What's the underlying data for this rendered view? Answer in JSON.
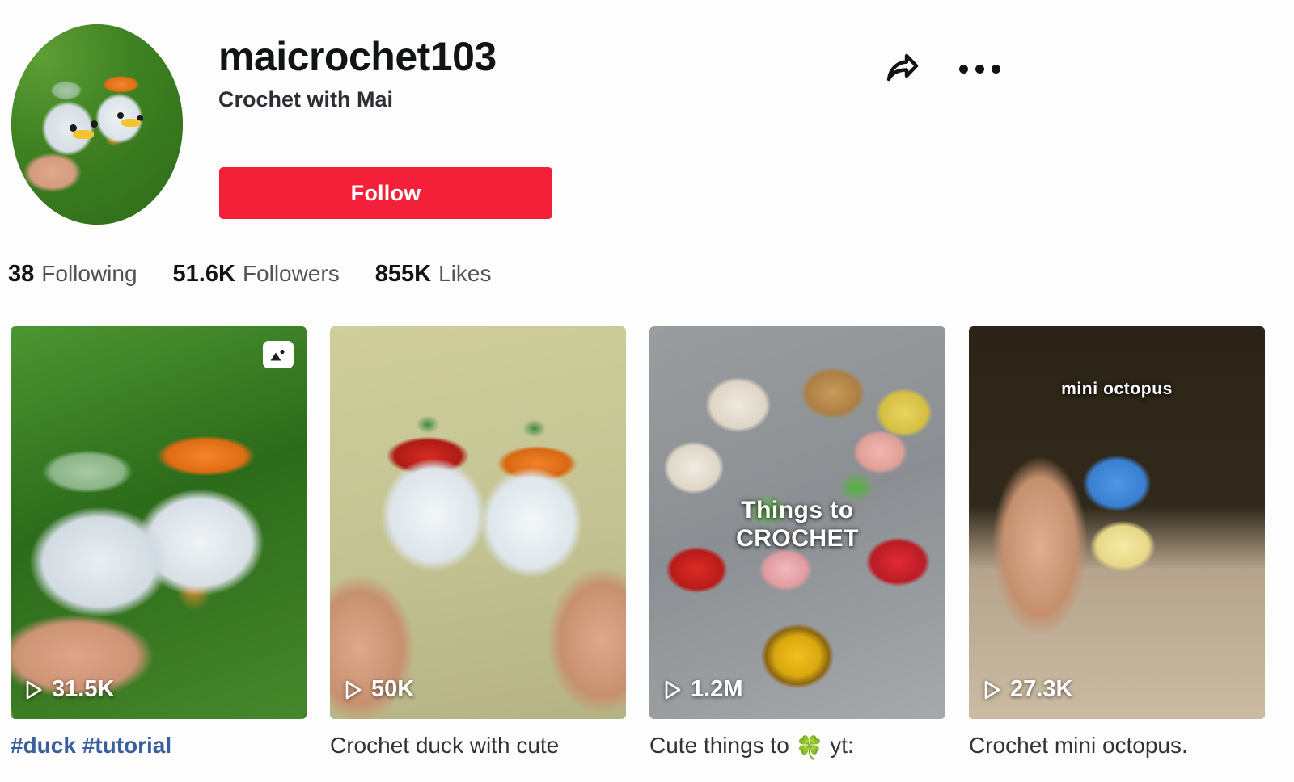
{
  "profile": {
    "username": "maicrochet103",
    "display_name": "Crochet with Mai",
    "follow_label": "Follow",
    "avatar_alt": "crochet duck avatar",
    "actions": {
      "share_icon": "share-arrow-icon",
      "more_icon": "more-options-icon"
    }
  },
  "stats": [
    {
      "value": "38",
      "label": "Following"
    },
    {
      "value": "51.6K",
      "label": "Followers"
    },
    {
      "value": "855K",
      "label": "Likes"
    }
  ],
  "videos": [
    {
      "play_count": "31.5K",
      "caption": "#duck #tutorial",
      "caption_is_link": true,
      "overlay_text": "",
      "badge": "photo-carousel-icon",
      "alt": "two crochet ducks held over grass"
    },
    {
      "play_count": "50K",
      "caption": "Crochet duck with cute",
      "caption_is_link": false,
      "overlay_text": "",
      "badge": "",
      "alt": "two crochet ducks with strawberry and pumpkin hats"
    },
    {
      "play_count": "1.2M",
      "caption_prefix": "Cute things to ",
      "caption_emoji": "🍀",
      "caption_suffix": " yt:",
      "caption": "Cute things to 🍀 yt:",
      "caption_is_link": false,
      "overlay_text": "Things to\nCROCHET",
      "overlay_line1": "Things to",
      "overlay_line2": "CROCHET",
      "badge": "",
      "alt": "pile of crochet animals fruits and a sunflower"
    },
    {
      "play_count": "27.3K",
      "caption": "Crochet mini octopus.",
      "caption_is_link": false,
      "overlay_text": "mini octopus",
      "badge": "",
      "alt": "hand holding blue and yellow crochet mini octopus"
    }
  ],
  "colors": {
    "brand_red": "#f4203a",
    "link_blue": "#3a5f9e",
    "text_primary": "#111416",
    "text_secondary": "#4f5358",
    "background": "#fdfdfd"
  }
}
